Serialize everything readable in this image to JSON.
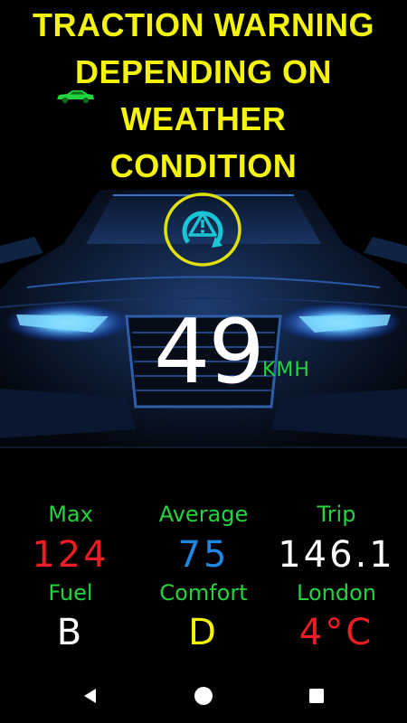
{
  "headline": {
    "lines": [
      "TRACTION WARNING",
      "DEPENDING ON",
      "WEATHER",
      "CONDITION"
    ]
  },
  "speed": {
    "value": "49",
    "unit": "KMH"
  },
  "stats": {
    "max": {
      "label": "Max",
      "value": "124",
      "color": "#ee1c24"
    },
    "average": {
      "label": "Average",
      "value": "75",
      "color": "#1e88e5"
    },
    "trip": {
      "label": "Trip",
      "value": "146.1",
      "color": "#ffffff"
    },
    "fuel": {
      "label": "Fuel",
      "value": "B",
      "color": "#ffffff"
    },
    "comfort": {
      "label": "Comfort",
      "value": "D",
      "color": "#f3f30c"
    },
    "location": {
      "label": "London",
      "value": "4°C",
      "color": "#ee1c24"
    }
  },
  "colors": {
    "headline": "#f3f30c",
    "label_green": "#23d33f",
    "warning_ring": "#e0e00a",
    "warning_icon": "#19c6d6"
  },
  "icons": {
    "car_badge": "car-icon",
    "warning": "traction-warning-icon",
    "nav_back": "back-triangle-icon",
    "nav_home": "home-circle-icon",
    "nav_recents": "recents-square-icon"
  }
}
